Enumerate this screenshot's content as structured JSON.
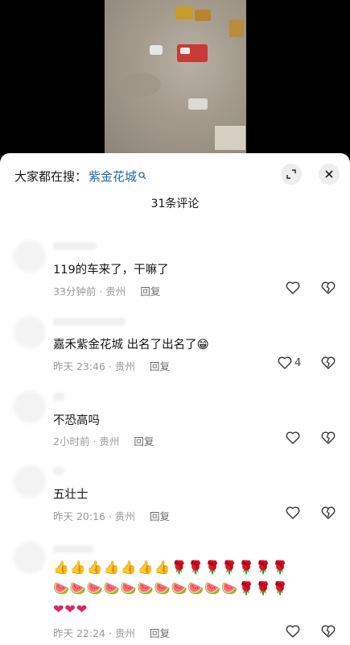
{
  "header": {
    "search_prefix": "大家都在搜：",
    "search_keyword": "紫金花城",
    "comment_count": "31条评论"
  },
  "icons": {
    "search": "search-icon",
    "minimize": "minimize-icon",
    "close": "close-icon",
    "like": "heart-icon",
    "dislike": "broken-heart-icon"
  },
  "comments": [
    {
      "text": "119的车来了，干嘛了",
      "time": "33分钟前",
      "location": "贵州",
      "reply": "回复",
      "likes": ""
    },
    {
      "text": "嘉禾紫金花城   出名了出名了😁",
      "time": "昨天 23:46",
      "location": "贵州",
      "reply": "回复",
      "likes": "4"
    },
    {
      "text": "不恐高吗",
      "time": "2小时前",
      "location": "贵州",
      "reply": "回复",
      "likes": ""
    },
    {
      "text": "五壮士",
      "time": "昨天 20:16",
      "location": "贵州",
      "reply": "回复",
      "likes": ""
    },
    {
      "text_lines": [
        "👍👍👍👍👍👍👍🌹🌹🌹🌹🌹🌹🌹",
        "🍉🍉🍉🍉🍉🍉🍉🍉🍉🍉🍉🌹🌹🌹",
        "❤❤❤"
      ],
      "time": "昨天 22:24",
      "location": "贵州",
      "reply": "回复",
      "likes": ""
    }
  ],
  "colors": {
    "keyword": "#1e6aa8",
    "meta": "#9a9a9a",
    "sheet": "#ffffff"
  }
}
